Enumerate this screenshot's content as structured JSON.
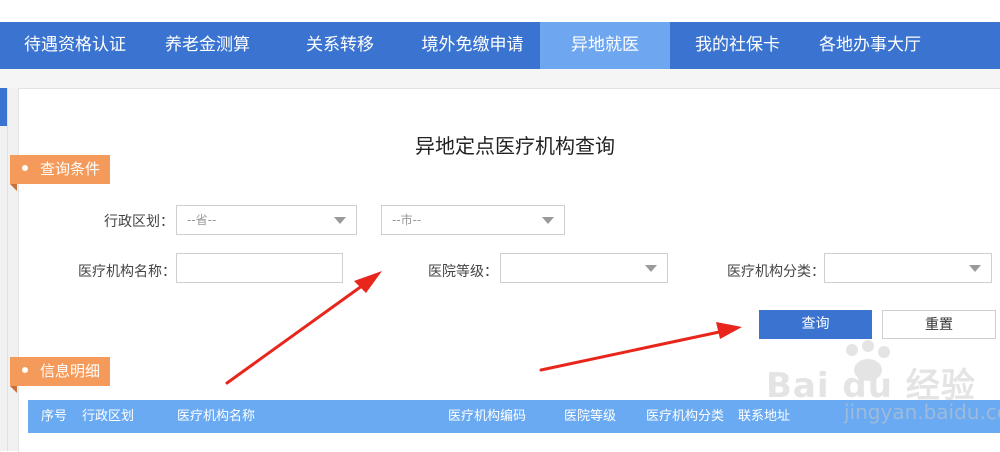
{
  "nav": {
    "items": [
      "待遇资格认证",
      "养老金测算",
      "关系转移",
      "境外免缴申请",
      "异地就医",
      "我的社保卡",
      "各地办事大厅"
    ],
    "active": "异地就医"
  },
  "page": {
    "title": "异地定点医疗机构查询"
  },
  "query": {
    "section_label": "查询条件",
    "region_label": "行政区划：",
    "province_placeholder": "--省--",
    "city_placeholder": "--市--",
    "name_label": "医疗机构名称：",
    "name_value": "",
    "level_label": "医院等级：",
    "level_value": "",
    "category_label": "医疗机构分类：",
    "category_value": "",
    "search_button": "查询",
    "reset_button": "重置"
  },
  "results": {
    "section_label": "信息明细",
    "columns": [
      "序号",
      "行政区划",
      "医疗机构名称",
      "医疗机构编码",
      "医院等级",
      "医疗机构分类",
      "联系地址"
    ]
  },
  "watermark": {
    "brand": "Bai du 经验",
    "url": "jingyan.baidu.com"
  },
  "colors": {
    "nav": "#3a74d0",
    "nav_active": "#6ea6f0",
    "tag": "#f49a5a",
    "table_header": "#6aaaf2",
    "arrow": "#e8261c"
  },
  "icons": [
    "chevron-down-icon",
    "bullet-dot-icon",
    "red-arrow-annotation",
    "baidu-paw-logo"
  ]
}
